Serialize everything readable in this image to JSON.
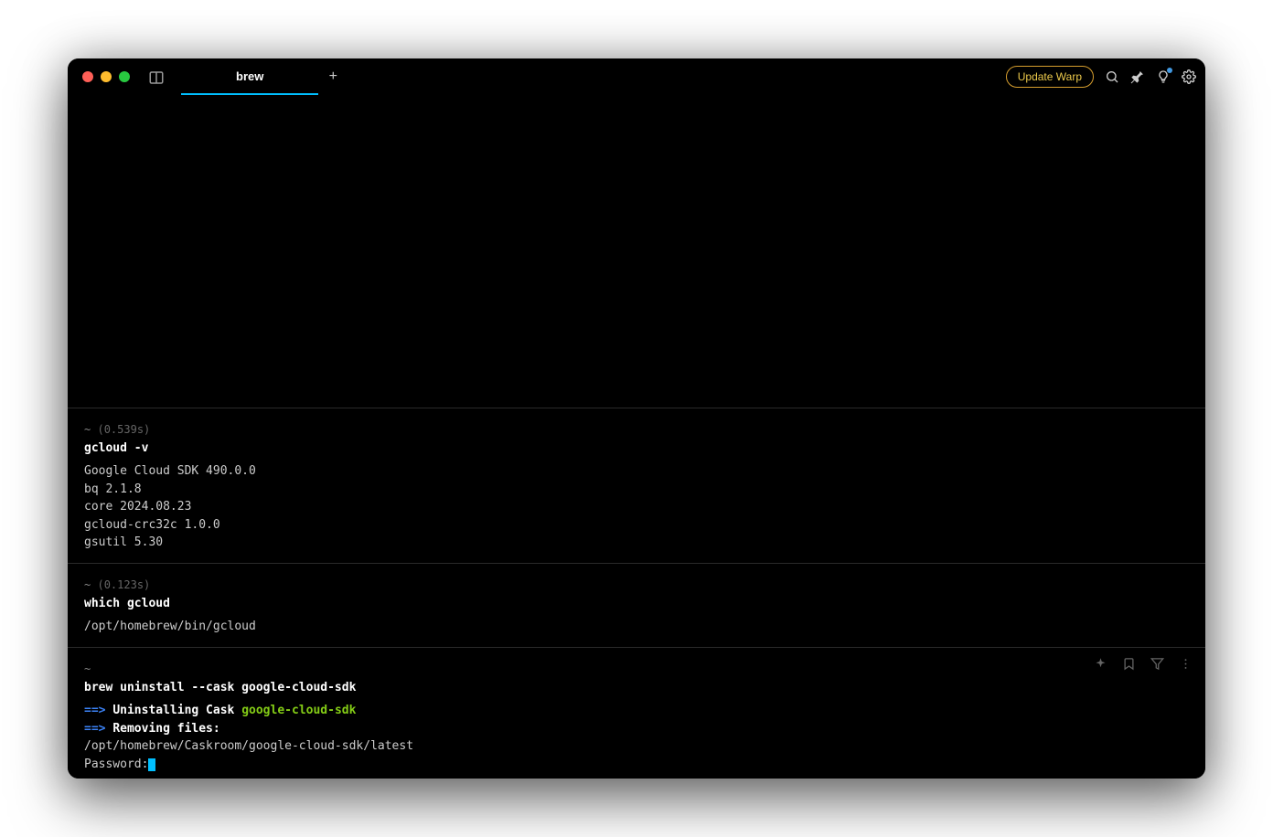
{
  "titlebar": {
    "tab_label": "brew",
    "update_label": "Update Warp"
  },
  "blocks": [
    {
      "prompt_path": "~",
      "prompt_time": "(0.539s)",
      "command": "gcloud -v",
      "output": "Google Cloud SDK 490.0.0\nbq 2.1.8\ncore 2024.08.23\ngcloud-crc32c 1.0.0\ngsutil 5.30"
    },
    {
      "prompt_path": "~",
      "prompt_time": "(0.123s)",
      "command": "which gcloud",
      "output": "/opt/homebrew/bin/gcloud"
    }
  ],
  "current": {
    "prompt_path": "~",
    "command": "brew uninstall --cask google-cloud-sdk",
    "arrow": "==>",
    "line1_text": "Uninstalling Cask",
    "line1_pkg": "google-cloud-sdk",
    "line2_text": "Removing files:",
    "line3": "/opt/homebrew/Caskroom/google-cloud-sdk/latest",
    "password_prompt": "Password:"
  }
}
